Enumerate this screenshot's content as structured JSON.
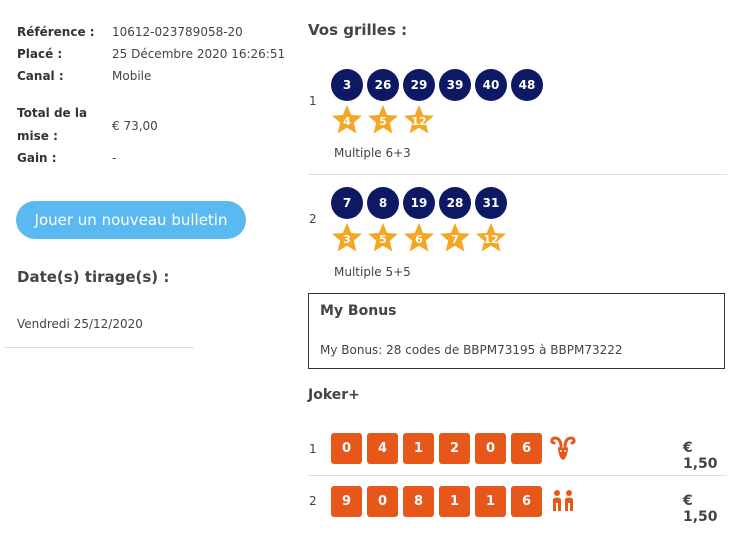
{
  "summary": {
    "reference_label": "Référence :",
    "reference_value": "10612-023789058-20",
    "placed_label": "Placé :",
    "placed_value": "25 Décembre 2020 16:26:51",
    "channel_label": "Canal :",
    "channel_value": "Mobile",
    "total_label_line1": "Total de la",
    "total_label_line2": "mise :",
    "total_value": "€ 73,00",
    "gain_label": "Gain :",
    "gain_value": "-"
  },
  "play_button_label": "Jouer un nouveau bulletin",
  "draw_dates": {
    "title": "Date(s) tirage(s) :",
    "date": "Vendredi 25/12/2020"
  },
  "grids": {
    "title": "Vos grilles :",
    "items": [
      {
        "index": "1",
        "numbers": [
          "3",
          "26",
          "29",
          "39",
          "40",
          "48"
        ],
        "stars": [
          "4",
          "5",
          "12"
        ],
        "type": "Multiple 6+3"
      },
      {
        "index": "2",
        "numbers": [
          "7",
          "8",
          "19",
          "28",
          "31"
        ],
        "stars": [
          "3",
          "5",
          "6",
          "7",
          "12"
        ],
        "type": "Multiple 5+5"
      }
    ]
  },
  "bonus": {
    "title": "My Bonus",
    "text": "My Bonus: 28 codes de BBPM73195 à BBPM73222"
  },
  "joker": {
    "title": "Joker+",
    "rows": [
      {
        "index": "1",
        "digits": [
          "0",
          "4",
          "1",
          "2",
          "0",
          "6"
        ],
        "sign_icon": "aries-icon",
        "amount": "€ 1,50"
      },
      {
        "index": "2",
        "digits": [
          "9",
          "0",
          "8",
          "1",
          "1",
          "6"
        ],
        "sign_icon": "gemini-icon",
        "amount": "€ 1,50"
      }
    ]
  },
  "colors": {
    "ball": "#0d1963",
    "star": "#f5a623",
    "joker_digit": "#e8571a",
    "button": "#5ab9f0"
  }
}
